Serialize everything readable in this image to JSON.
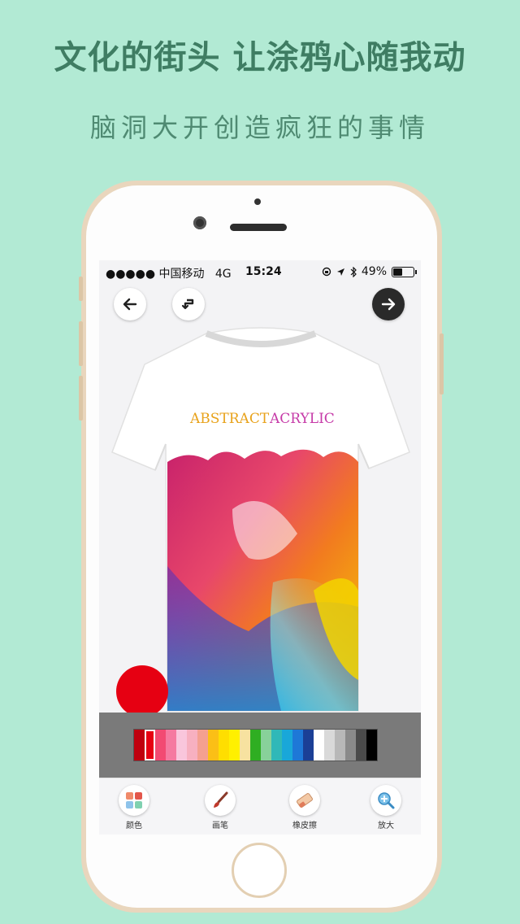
{
  "promo": {
    "headline": "文化的街头 让涂鸦心随我动",
    "subline": "脑洞大开创造疯狂的事情"
  },
  "status_bar": {
    "carrier": "●●●●● 中国移动",
    "network": "4G",
    "time": "15:24",
    "battery": "49%",
    "battery_level": 0.49
  },
  "nav": {
    "back_icon": "arrow-left-icon",
    "undo_icon": "undo-icon",
    "next_icon": "arrow-right-icon"
  },
  "design": {
    "print_text_word1": "ABSTRACT",
    "print_text_word2": "ACRYLIC",
    "word1_color": "#e8a21a",
    "word2_color": "#c63aa8"
  },
  "brush": {
    "selected_color": "#e60012"
  },
  "palette": {
    "selected_index": 1,
    "colors": [
      "#c0000e",
      "#e60012",
      "#f24a72",
      "#f57aa0",
      "#f9c6dc",
      "#f7b0c0",
      "#f4a090",
      "#fbbf16",
      "#ffde00",
      "#fff000",
      "#f7e2a0",
      "#2fae22",
      "#88d19a",
      "#30b8b8",
      "#19a7d9",
      "#1e78d7",
      "#1b3f96",
      "#ffffff",
      "#d9d9d9",
      "#b8b8b8",
      "#8a8a8a",
      "#4a4a4a",
      "#000000"
    ]
  },
  "toolbar": {
    "items": [
      {
        "label": "颜色",
        "icon": "color-grid-icon"
      },
      {
        "label": "画笔",
        "icon": "brush-icon"
      },
      {
        "label": "橡皮擦",
        "icon": "eraser-icon"
      },
      {
        "label": "放大",
        "icon": "zoom-in-icon"
      }
    ]
  }
}
